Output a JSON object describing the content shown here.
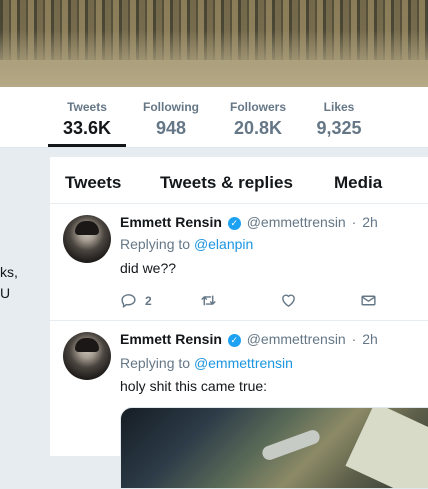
{
  "profile_nav": {
    "stats": [
      {
        "label": "Tweets",
        "value": "33.6K"
      },
      {
        "label": "Following",
        "value": "948"
      },
      {
        "label": "Followers",
        "value": "20.8K"
      },
      {
        "label": "Likes",
        "value": "9,325"
      }
    ]
  },
  "left_fragments": [
    "ks,",
    "U"
  ],
  "tabs": [
    "Tweets",
    "Tweets & replies",
    "Media"
  ],
  "tweets": [
    {
      "name": "Emmett Rensin",
      "handle": "@emmettrensin",
      "separator": "·",
      "time": "2h",
      "reply_prefix": "Replying to",
      "reply_to": "@elanpin",
      "text": "did we??",
      "reply_count": "2"
    },
    {
      "name": "Emmett Rensin",
      "handle": "@emmettrensin",
      "separator": "·",
      "time": "2h",
      "reply_prefix": "Replying to",
      "reply_to": "@emmettrensin",
      "text": "holy shit this came true:"
    }
  ],
  "icons": {
    "verified": "verified-badge-icon",
    "reply": "reply-icon",
    "retweet": "retweet-icon",
    "like": "heart-icon",
    "dm": "envelope-icon"
  },
  "colors": {
    "accent": "#1da1f2",
    "link": "#1b95e0",
    "muted": "#657786",
    "background": "#e6ecf0"
  }
}
